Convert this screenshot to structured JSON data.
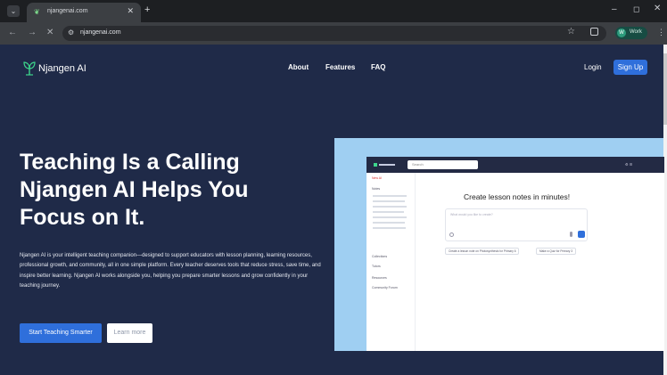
{
  "browser": {
    "tab_title": "njangenai.com",
    "url": "njangenai.com",
    "profile_label": "Work",
    "profile_initial": "W"
  },
  "site": {
    "brand": "Njangen AI",
    "nav": [
      "About",
      "Features",
      "FAQ"
    ],
    "login": "Login",
    "signup": "Sign Up"
  },
  "hero": {
    "headline": [
      "Teaching Is a Calling",
      "Njangen AI Helps You",
      "Focus on It."
    ],
    "description": "Njangen AI is your intelligent teaching companion—designed to support educators with lesson planning, learning resources, professional growth, and community, all in one simple platform. Every teacher deserves tools that reduce stress, save time, and inspire better learning. Njangen AI works alongside you, helping you prepare smarter lessons and grow confidently in your teaching journey.",
    "primary_cta": "Start Teaching Smarter",
    "secondary_cta": "Learn more"
  },
  "preview": {
    "search": "Search",
    "sidebar": [
      "New AI",
      "Notes",
      "Collections",
      "Tutors",
      "Resources",
      "Community Forum"
    ],
    "title": "Create lesson notes in minutes!",
    "input_placeholder": "What would you like to create?",
    "chips": [
      "Create a lesson note on Photosynthesis for Primary 6",
      "Make a Quiz for Primary 3"
    ]
  },
  "colors": {
    "page_bg": "#1f2a48",
    "accent": "#2f6fdb",
    "preview_bg": "#9fcff2",
    "logo_green": "#3dd68c"
  }
}
